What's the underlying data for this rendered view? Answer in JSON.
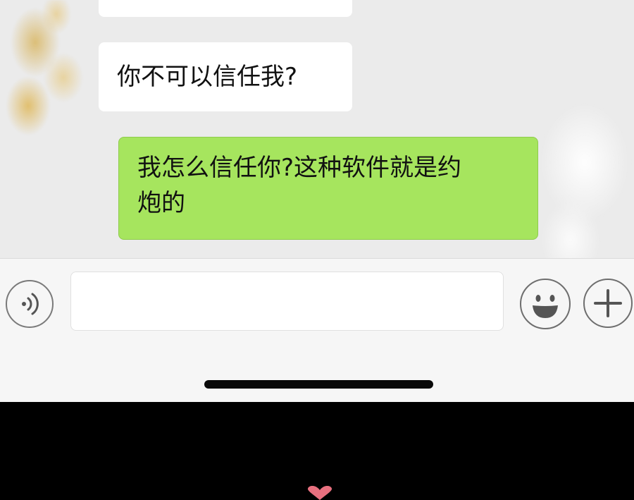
{
  "messages": [
    {
      "side": "left",
      "text": "你不可以信任我?"
    },
    {
      "side": "right",
      "lines": [
        "我怎么信任你?这种软件就是约",
        "炮的"
      ]
    }
  ],
  "input": {
    "value": "",
    "placeholder": ""
  },
  "icons": {
    "voice": "voice-icon",
    "emoji": "emoji-icon",
    "plus": "plus-icon",
    "heart": "heart-icon"
  },
  "colors": {
    "background": "#ebebeb",
    "incoming_bubble": "#ffffff",
    "outgoing_bubble": "#a6e55e",
    "input_bar": "#f6f6f6",
    "heart": "#e8707f"
  }
}
